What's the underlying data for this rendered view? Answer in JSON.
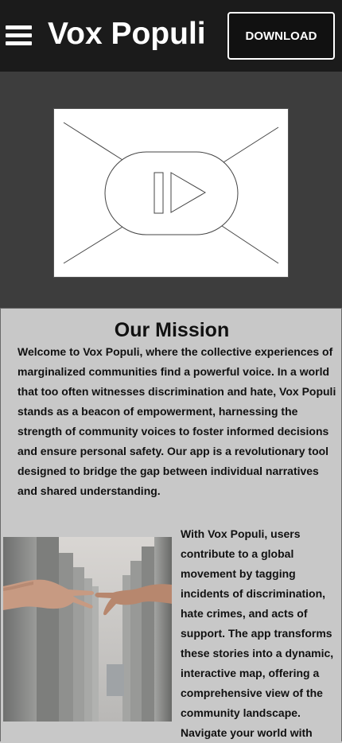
{
  "header": {
    "menu_icon": "hamburger-menu-icon",
    "title": "Vox Populi",
    "download_label": "DOWNLOAD"
  },
  "hero": {
    "video_placeholder_icon": "video-play-icon"
  },
  "mission": {
    "title": "Our Mission",
    "paragraph": "Welcome to Vox Populi, where the collective experiences of marginalized communities find a powerful voice. In a world that too often witnesses discrimination and hate, Vox Populi stands as a beacon of empowerment, harnessing the strength of community voices to foster informed decisions and ensure personal safety. Our app is a revolutionary tool designed to bridge the gap between individual narratives and shared understanding.",
    "side_paragraph": "With Vox Populi, users contribute to a global movement by tagging incidents of discrimination, hate crimes, and acts of support. The app transforms these stories into a dynamic, interactive map, offering a comprehensive view of the community landscape. Navigate your world with"
  },
  "colors": {
    "header_bg": "#1b1b1b",
    "hero_bg": "#3d3d3d",
    "content_bg": "#c8c8c8"
  }
}
